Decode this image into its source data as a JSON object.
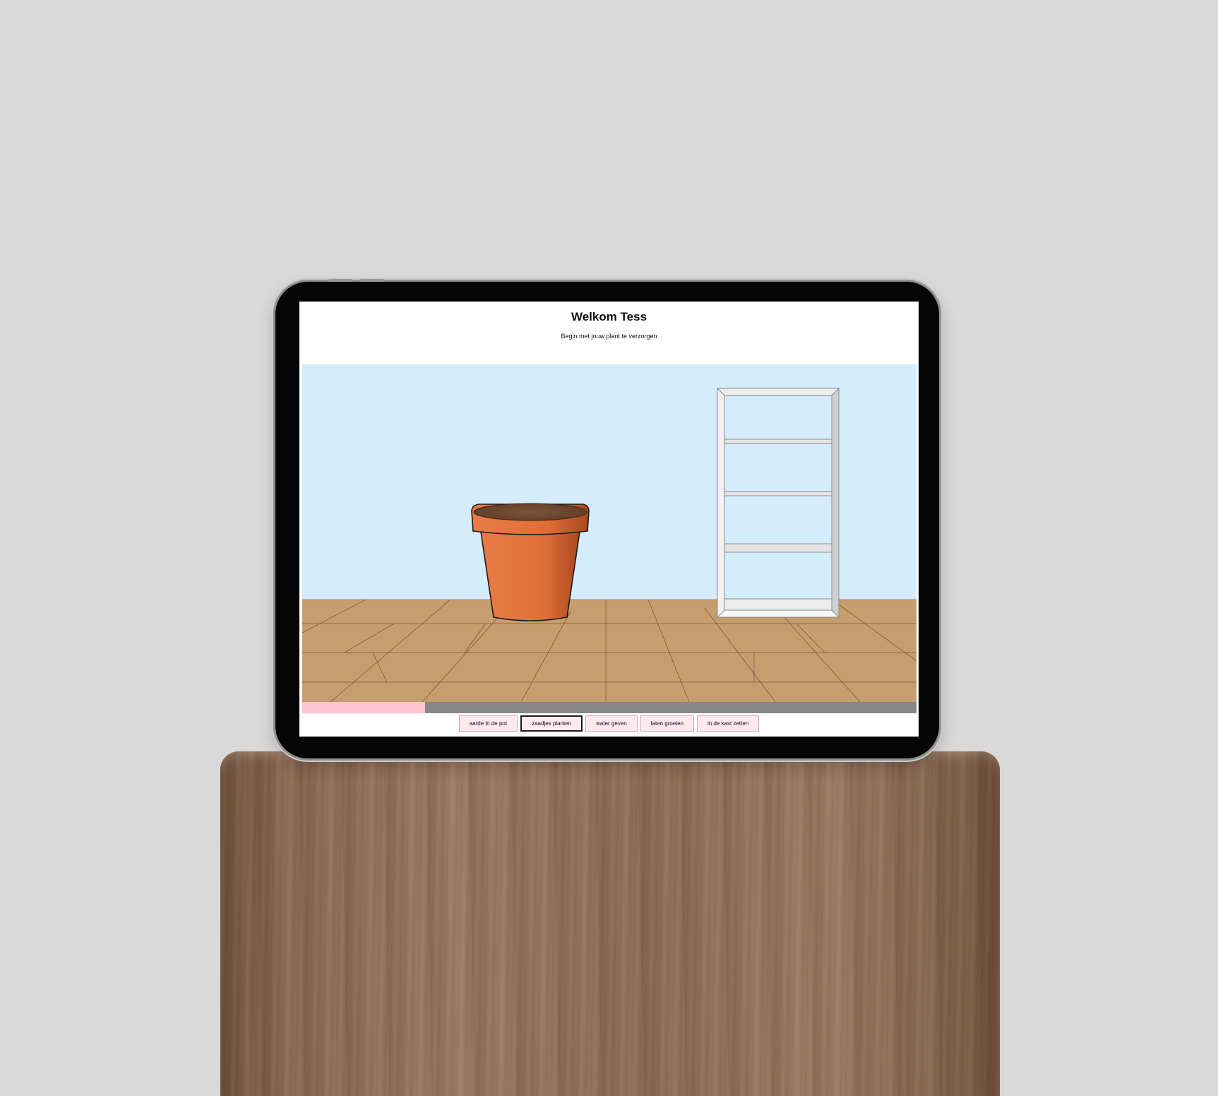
{
  "header": {
    "title": "Welkom Tess",
    "subtitle": "Begin met jouw plant te verzorgen"
  },
  "progress": {
    "fraction": 0.2
  },
  "actions": [
    {
      "label": "aarde in de pot",
      "active": false
    },
    {
      "label": "zaadjes planten",
      "active": true
    },
    {
      "label": "water geven",
      "active": false
    },
    {
      "label": "laten groeien",
      "active": false
    },
    {
      "label": "in de kast zetten",
      "active": false
    }
  ],
  "colors": {
    "wall": "#d4ecfc",
    "floor": "#c59d6f",
    "pot": "#e06e38",
    "soil": "#7a5034",
    "progress_fill": "#ffc4cf",
    "progress_track": "#878787",
    "button_bg": "#ffe8ee"
  }
}
